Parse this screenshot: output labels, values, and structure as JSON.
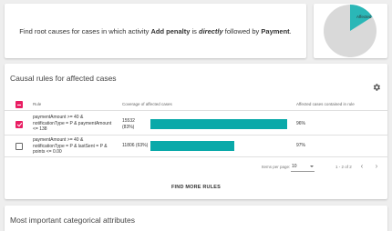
{
  "question": {
    "prefix": "Find root causes for cases in which activity ",
    "activity_a": "Add penalty",
    "mid": " is ",
    "relation": "directly",
    "mid2": " followed by ",
    "activity_b": "Payment",
    "suffix": "."
  },
  "pie": {
    "label": "Affected",
    "affected_fraction": 0.16,
    "affected_color": "#2ab7b7",
    "rest_color": "#d9d9d9"
  },
  "rules_card": {
    "title": "Causal rules for affected cases",
    "columns": {
      "rule": "Rule",
      "coverage": "Coverage of affected cases",
      "contained": "Affected cases contained in rule"
    },
    "rows": [
      {
        "rule_lines": [
          "paymentAmount >= 40 &",
          "notificationType = P & paymentAmount",
          "<= 138"
        ],
        "coverage_lines": [
          "15532",
          "(83%)"
        ],
        "coverage_fraction": 0.83,
        "contained": "96%",
        "checked": true
      },
      {
        "rule_lines": [
          "paymentAmount >= 40 &",
          "notificationType = P & lastSent = P &",
          "points <= 0.00"
        ],
        "coverage_lines": [
          "11806 (63%)"
        ],
        "coverage_fraction": 0.63,
        "contained": "97%",
        "checked": false
      }
    ],
    "paginator": {
      "items_label": "Items per page:",
      "page_size": "10",
      "range": "1 - 2 of 2",
      "prev": "‹",
      "next": "›"
    },
    "find_more": "FIND MORE RULES"
  },
  "attr_card": {
    "title": "Most important categorical attributes"
  },
  "colors": {
    "accent_pink": "#e91e63",
    "bar_teal": "#0aa9a9"
  }
}
